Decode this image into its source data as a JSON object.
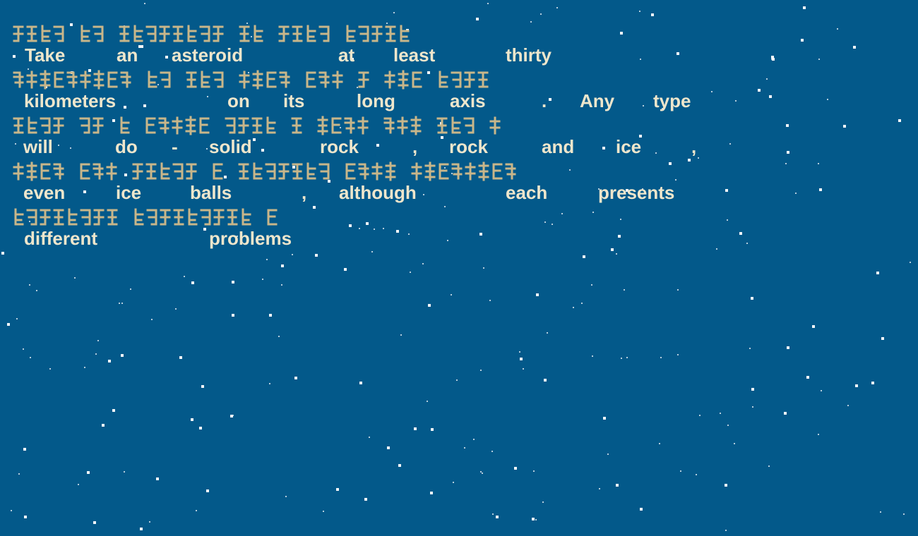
{
  "colors": {
    "background": "#03598a",
    "glyph": "#c8b68a",
    "text": "#eee6cc",
    "star": "#ffffff"
  },
  "lines": [
    {
      "glyph_groups": [
        4,
        2,
        8,
        2,
        4,
        5
      ],
      "words": [
        "Take",
        "an",
        "asteroid",
        "at",
        "least",
        "thirty"
      ]
    },
    {
      "glyph_groups": [
        9,
        2,
        3,
        4,
        3,
        1,
        3,
        4
      ],
      "words": [
        "kilometers",
        "on",
        "its",
        "long",
        "axis",
        ".",
        "Any",
        "type"
      ]
    },
    {
      "glyph_groups": [
        4,
        2,
        1,
        5,
        4,
        1,
        4,
        3,
        3,
        1
      ],
      "words": [
        "will",
        "do",
        "-",
        "solid",
        "rock",
        ",",
        "rock",
        "and",
        "ice",
        ","
      ]
    },
    {
      "glyph_groups": [
        4,
        3,
        5,
        1,
        7,
        4,
        8
      ],
      "words": [
        "even",
        "ice",
        "balls",
        ",",
        "although",
        "each",
        "presents"
      ]
    },
    {
      "glyph_groups": [
        8,
        9,
        1
      ],
      "words": [
        "different",
        "problems"
      ]
    }
  ]
}
